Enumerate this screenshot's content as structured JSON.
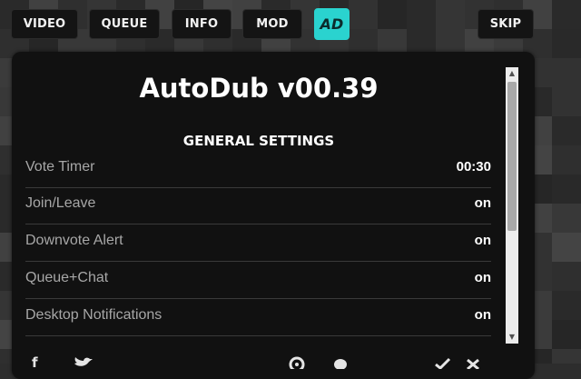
{
  "nav": {
    "video": "VIDEO",
    "queue": "QUEUE",
    "info": "INFO",
    "mod": "MOD",
    "ad_badge": "AD",
    "skip": "SKIP"
  },
  "colors": {
    "accent": "#2ad3cf",
    "panel_bg": "#111111"
  },
  "panel": {
    "title": "AutoDub v00.39",
    "section_title": "GENERAL SETTINGS",
    "settings": [
      {
        "label": "Vote Timer",
        "value": "00:30"
      },
      {
        "label": "Join/Leave",
        "value": "on"
      },
      {
        "label": "Downvote Alert",
        "value": "on"
      },
      {
        "label": "Queue+Chat",
        "value": "on"
      },
      {
        "label": "Desktop Notifications",
        "value": "on"
      }
    ]
  },
  "footer_icons": [
    "facebook-icon",
    "twitter-icon",
    "settings-icon",
    "chat-icon",
    "check-icon",
    "close-icon"
  ]
}
